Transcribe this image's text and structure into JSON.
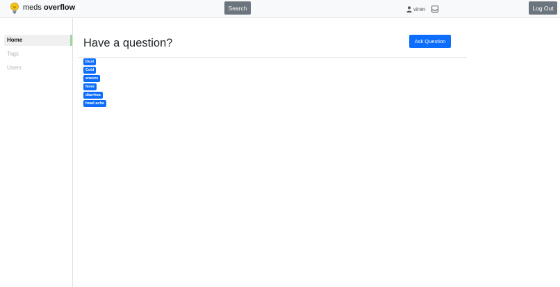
{
  "header": {
    "logo_icon": "lightbulb-icon",
    "brand_prefix": "meds",
    "brand_bold": "overflow",
    "search_label": "Search",
    "user_icon": "person-icon",
    "user_name": "viren",
    "inbox_icon": "inbox-icon",
    "logout_label": "Log Out"
  },
  "sidebar": {
    "items": [
      {
        "label": "Home",
        "active": true
      },
      {
        "label": "Tags",
        "active": false
      },
      {
        "label": "Users",
        "active": false
      }
    ]
  },
  "main": {
    "title": "Have a question?",
    "ask_label": "Ask Question",
    "tags": [
      "Dust",
      "Cold",
      "sneeze",
      "fever",
      "diarrhea",
      "head ache"
    ]
  },
  "colors": {
    "primary": "#0d6efd",
    "secondary": "#6c757d",
    "active_indicator": "#9bd89f",
    "navbar_bg": "#f8f9fa",
    "logo_bulb": "#f5c518"
  }
}
